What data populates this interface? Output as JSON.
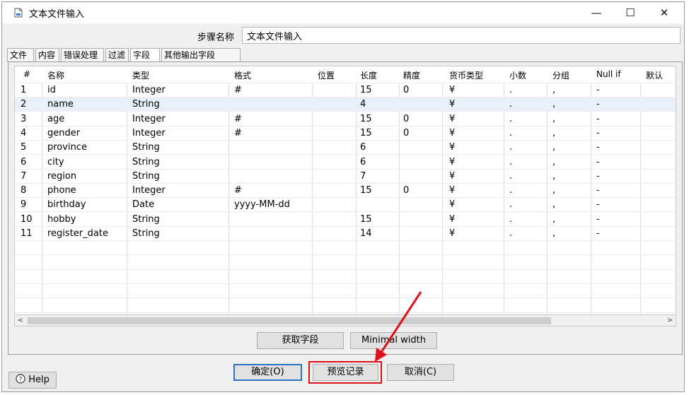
{
  "window": {
    "title": "文本文件输入",
    "min_glyph": "—",
    "max_glyph": "☐",
    "close_glyph": "✕"
  },
  "step": {
    "label": "步骤名称",
    "value": "文本文件输入"
  },
  "tabs": [
    {
      "label": "文件",
      "active": false
    },
    {
      "label": "内容",
      "active": false
    },
    {
      "label": "错误处理",
      "active": false
    },
    {
      "label": "过滤",
      "active": false
    },
    {
      "label": "字段",
      "active": true
    },
    {
      "label": "其他输出字段",
      "active": false
    }
  ],
  "table": {
    "headers": [
      "#",
      "名称",
      "类型",
      "格式",
      "位置",
      "长度",
      "精度",
      "货币类型",
      "小数",
      "分组",
      "Null if",
      "默认"
    ],
    "rows": [
      [
        "1",
        "id",
        "Integer",
        "#",
        "",
        "15",
        "0",
        "¥",
        ".",
        ",",
        "-",
        ""
      ],
      [
        "2",
        "name",
        "String",
        "",
        "",
        "4",
        "",
        "¥",
        ".",
        ",",
        "-",
        ""
      ],
      [
        "3",
        "age",
        "Integer",
        "#",
        "",
        "15",
        "0",
        "¥",
        ".",
        ",",
        "-",
        ""
      ],
      [
        "4",
        "gender",
        "Integer",
        "#",
        "",
        "15",
        "0",
        "¥",
        ".",
        ",",
        "-",
        ""
      ],
      [
        "5",
        "province",
        "String",
        "",
        "",
        "6",
        "",
        "¥",
        ".",
        ",",
        "-",
        ""
      ],
      [
        "6",
        "city",
        "String",
        "",
        "",
        "6",
        "",
        "¥",
        ".",
        ",",
        "-",
        ""
      ],
      [
        "7",
        "region",
        "String",
        "",
        "",
        "7",
        "",
        "¥",
        ".",
        ",",
        "-",
        ""
      ],
      [
        "8",
        "phone",
        "Integer",
        "#",
        "",
        "15",
        "0",
        "¥",
        ".",
        ",",
        "-",
        ""
      ],
      [
        "9",
        "birthday",
        "Date",
        "yyyy-MM-dd",
        "",
        "",
        "",
        "¥",
        ".",
        ",",
        "-",
        ""
      ],
      [
        "10",
        "hobby",
        "String",
        "",
        "",
        "15",
        "",
        "¥",
        ".",
        ",",
        "-",
        ""
      ],
      [
        "11",
        "register_date",
        "String",
        "",
        "",
        "14",
        "",
        "¥",
        ".",
        ",",
        "-",
        ""
      ]
    ],
    "selected_row": 2,
    "empty_rows": 5
  },
  "buttons": {
    "get_fields": "获取字段",
    "minimal_width": "Minimal width",
    "ok": "确定(O)",
    "preview": "预览记录",
    "cancel": "取消(C)",
    "help": "Help"
  },
  "scroll_left_glyph": "<",
  "scroll_right_glyph": ">",
  "annotation": {
    "highlight_color": "#e0101b"
  }
}
